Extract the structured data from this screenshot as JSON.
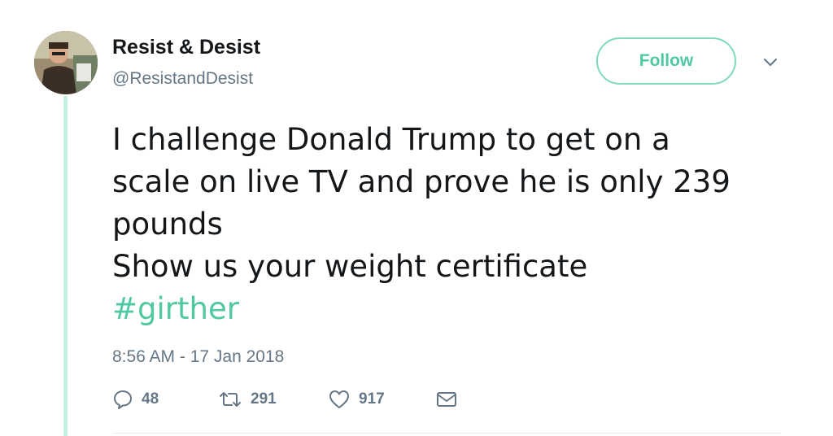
{
  "user": {
    "name": "Resist & Desist",
    "handle": "@ResistandDesist"
  },
  "follow_label": "Follow",
  "tweet": {
    "lines": [
      "I challenge Donald Trump to get on a",
      "scale on live TV and prove he is only 239",
      "pounds",
      "Show us your weight certificate"
    ],
    "hashtag": "#girther",
    "timestamp": "8:56 AM - 17 Jan 2018"
  },
  "stats": {
    "replies": "48",
    "retweets": "291",
    "likes": "917"
  },
  "colors": {
    "accent": "#4fc8a3",
    "thread_line": "#c6efe3",
    "muted": "#657786"
  },
  "icons": [
    "reply-icon",
    "retweet-icon",
    "like-icon",
    "message-icon",
    "chevron-down-icon"
  ]
}
